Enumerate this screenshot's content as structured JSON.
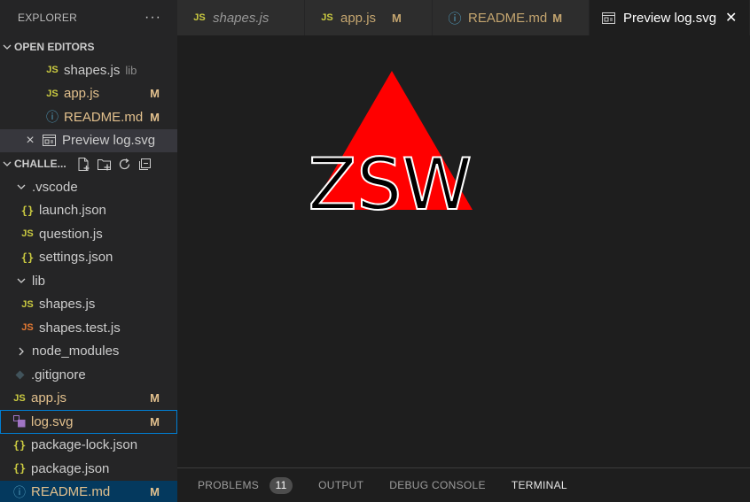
{
  "sidebar": {
    "title": "EXPLORER",
    "more": "···",
    "open_editors": {
      "header": "OPEN EDITORS",
      "items": [
        {
          "icon": "JS",
          "label": "shapes.js",
          "hint": "lib",
          "status": ""
        },
        {
          "icon": "JS",
          "label": "app.js",
          "hint": "",
          "status": "M"
        },
        {
          "icon": "ⓘ",
          "label": "README.md",
          "hint": "",
          "status": "M"
        },
        {
          "icon": "×",
          "label": "Preview log.svg",
          "hint": "",
          "status": ""
        }
      ]
    },
    "project": {
      "header": "CHALLE...",
      "folders": {
        "vscode": ".vscode",
        "lib": "lib",
        "node_modules": "node_modules"
      },
      "files": {
        "launch": "launch.json",
        "question": "question.js",
        "settings": "settings.json",
        "shapes": "shapes.js",
        "shapes_test": "shapes.test.js",
        "gitignore": ".gitignore",
        "app": "app.js",
        "log": "log.svg",
        "package_lock": "package-lock.json",
        "package": "package.json",
        "readme": "README.md"
      },
      "status_m": "M",
      "js_icon": "JS",
      "json_icon": "{}",
      "info_icon": "ⓘ"
    }
  },
  "tabs": [
    {
      "icon": "JS",
      "label": "shapes.js",
      "status": ""
    },
    {
      "icon": "JS",
      "label": "app.js",
      "status": "M"
    },
    {
      "icon": "ⓘ",
      "label": "README.md",
      "status": "M"
    },
    {
      "icon": "preview",
      "label": "Preview log.svg",
      "status": "",
      "close": "✕"
    }
  ],
  "preview": {
    "logo_text": "ZSW",
    "shape": "triangle",
    "shape_color": "#ff0000",
    "text_color": "#000000"
  },
  "panel": {
    "tabs": [
      "PROBLEMS",
      "OUTPUT",
      "DEBUG CONSOLE",
      "TERMINAL"
    ],
    "problems_count": "11"
  },
  "colors": {
    "accent": "#007fd4",
    "modified": "#e2c08d",
    "js_icon": "#cbcb41"
  }
}
